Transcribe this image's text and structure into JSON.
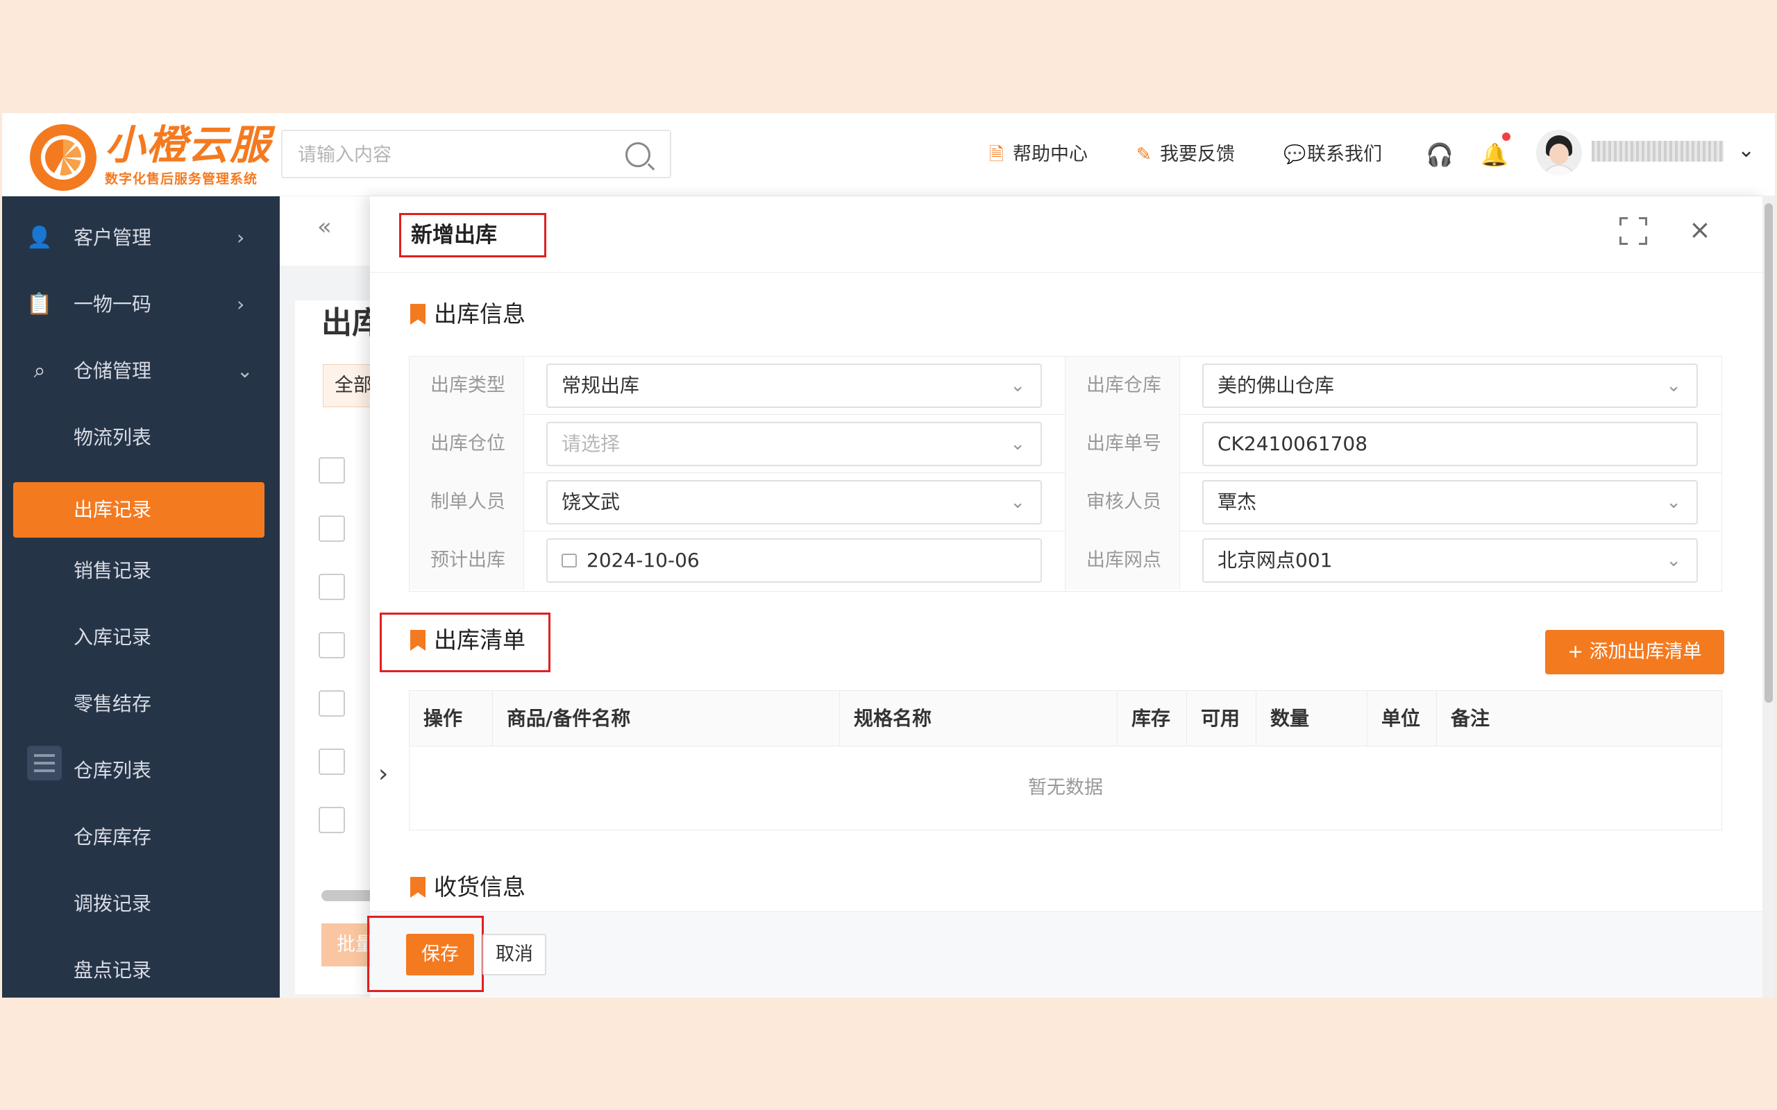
{
  "app": {
    "logo_title": "小橙云服",
    "logo_subtitle": "数字化售后服务管理系统"
  },
  "header": {
    "search_placeholder": "请输入内容",
    "links": [
      {
        "label": "帮助中心",
        "icon": "document-icon"
      },
      {
        "label": "我要反馈",
        "icon": "pen-icon"
      },
      {
        "label": "联系我们",
        "icon": "chat-icon"
      }
    ],
    "icons": [
      "headset-icon",
      "bell-icon"
    ],
    "notification_dot_color": "#f04040"
  },
  "sidebar": {
    "items": [
      {
        "label": "客户管理",
        "icon": "user-icon",
        "expanded": false
      },
      {
        "label": "一物一码",
        "icon": "clipboard-icon",
        "expanded": false
      },
      {
        "label": "仓储管理",
        "icon": "warehouse-icon",
        "expanded": true
      }
    ],
    "subitems": [
      {
        "label": "物流列表",
        "active": false
      },
      {
        "label": "出库记录",
        "active": true
      },
      {
        "label": "销售记录",
        "active": false
      },
      {
        "label": "入库记录",
        "active": false
      },
      {
        "label": "零售结存",
        "active": false
      },
      {
        "label": "仓库列表",
        "active": false
      },
      {
        "label": "仓库库存",
        "active": false
      },
      {
        "label": "调拨记录",
        "active": false
      },
      {
        "label": "盘点记录",
        "active": false
      }
    ],
    "bg_color": "#263448",
    "active_color": "#f47a20"
  },
  "main": {
    "title_partial": "出库",
    "chip_partial": "全部",
    "button_partial": "批量"
  },
  "drawer": {
    "title": "新增出库",
    "section_info": "出库信息",
    "fields": {
      "out_type_label": "出库类型",
      "out_type_value": "常规出库",
      "warehouse_label": "出库仓库",
      "warehouse_value": "美的佛山仓库",
      "location_label": "出库仓位",
      "location_placeholder": "请选择",
      "order_no_label": "出库单号",
      "order_no_value": "CK2410061708",
      "creator_label": "制单人员",
      "creator_value": "饶文武",
      "auditor_label": "审核人员",
      "auditor_value": "覃杰",
      "date_label": "预计出库",
      "date_value": "2024-10-06",
      "outlet_label": "出库网点",
      "outlet_value": "北京网点001"
    },
    "section_list": "出库清单",
    "add_button": "+ 添加出库清单",
    "table": {
      "columns": [
        "操作",
        "商品/备件名称",
        "规格名称",
        "库存",
        "可用",
        "数量",
        "单位",
        "备注"
      ],
      "empty_text": "暂无数据"
    },
    "section_receipt": "收货信息",
    "save_button": "保存",
    "cancel_button": "取消",
    "accent_color": "#f47a20",
    "highlight_color": "#e02020"
  }
}
